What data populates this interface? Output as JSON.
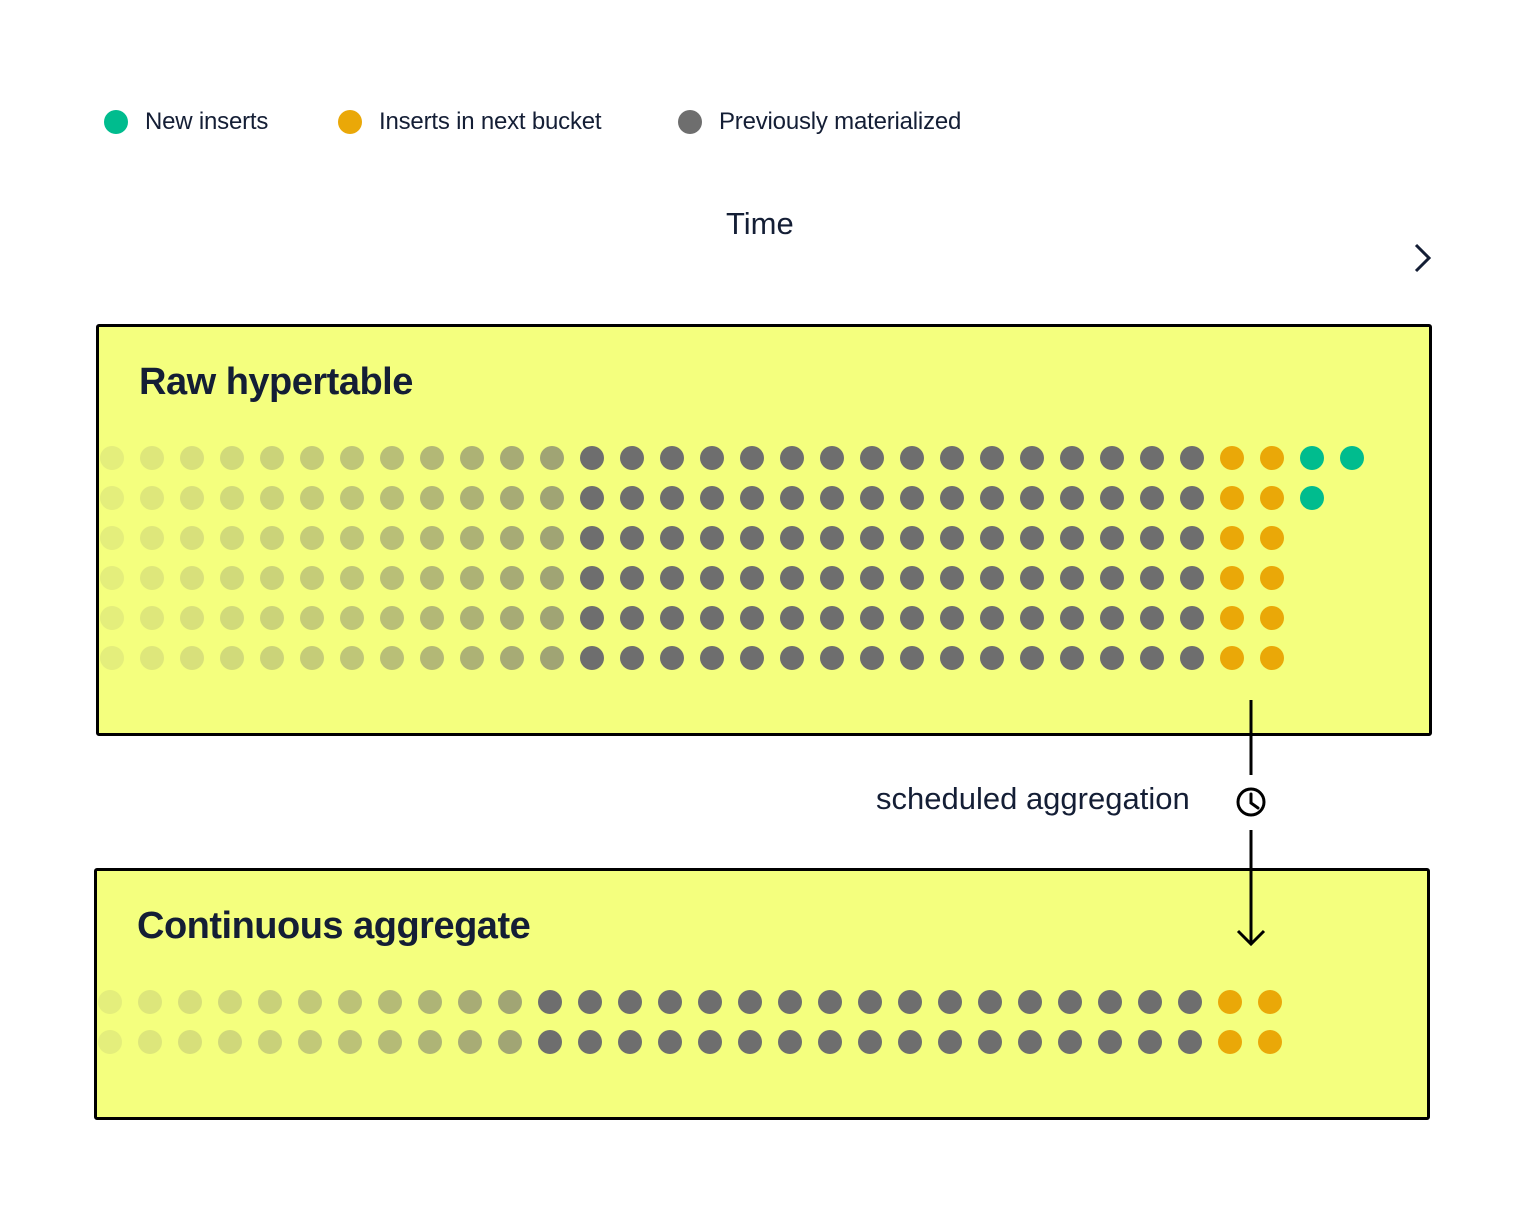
{
  "legend": {
    "items": [
      {
        "label": "New inserts",
        "color": "#00bc8e",
        "key": "new"
      },
      {
        "label": "Inserts in next bucket",
        "color": "#eaa808",
        "key": "next"
      },
      {
        "label": "Previously materialized",
        "color": "#6e6e6e",
        "key": "prev"
      }
    ]
  },
  "axis": {
    "label": "Time",
    "color": "#141e35"
  },
  "colors": {
    "panel_bg": "#f4ff7e",
    "border": "#000000",
    "text": "#141e35"
  },
  "raw_hypertable": {
    "title": "Raw hypertable",
    "rows": [
      {
        "materialized": 28,
        "next_bucket": 2,
        "new_inserts": 2
      },
      {
        "materialized": 28,
        "next_bucket": 2,
        "new_inserts": 1
      },
      {
        "materialized": 28,
        "next_bucket": 2,
        "new_inserts": 0
      },
      {
        "materialized": 28,
        "next_bucket": 2,
        "new_inserts": 0
      },
      {
        "materialized": 28,
        "next_bucket": 2,
        "new_inserts": 0
      },
      {
        "materialized": 28,
        "next_bucket": 2,
        "new_inserts": 0
      }
    ],
    "faded_leading_columns": 12
  },
  "connector": {
    "label": "scheduled aggregation",
    "icon": "clock-icon"
  },
  "continuous_aggregate": {
    "title": "Continuous aggregate",
    "rows": [
      {
        "materialized": 28,
        "next_bucket": 2,
        "new_inserts": 0
      },
      {
        "materialized": 28,
        "next_bucket": 2,
        "new_inserts": 0
      }
    ],
    "faded_leading_columns": 11
  }
}
